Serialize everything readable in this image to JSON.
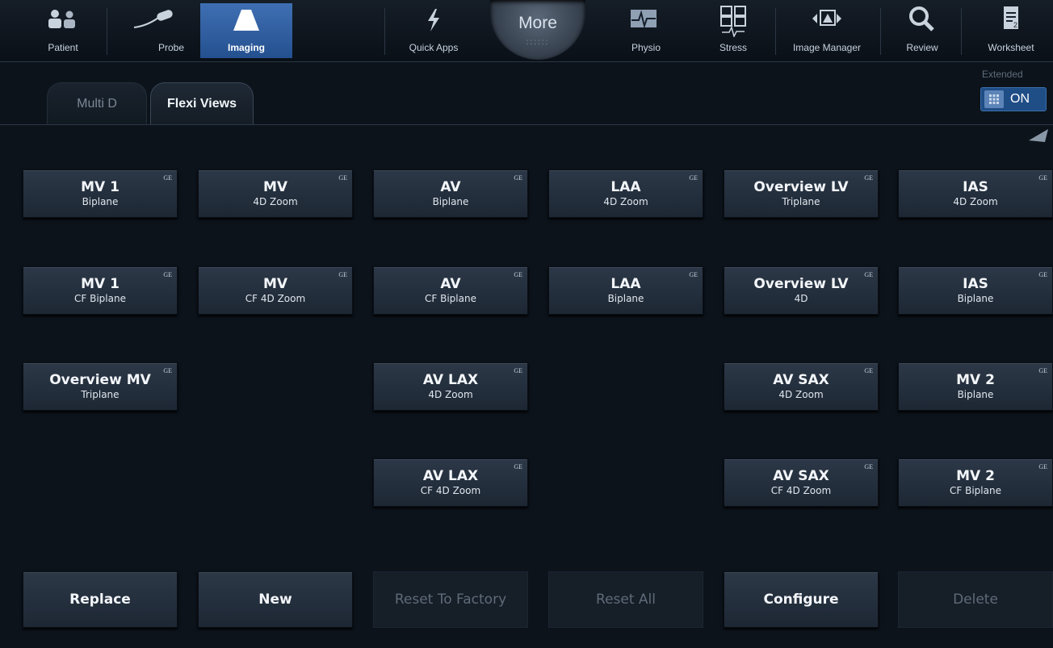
{
  "toolbar": {
    "items": [
      {
        "label": "Patient",
        "icon": "patient-icon"
      },
      {
        "label": "Probe",
        "icon": "probe-icon"
      },
      {
        "label": "Imaging",
        "icon": "imaging-icon",
        "active": true
      },
      {
        "label": "Quick Apps",
        "icon": "lightning-icon"
      },
      {
        "label": "Physio",
        "icon": "ecg-icon"
      },
      {
        "label": "Stress",
        "icon": "stress-icon"
      },
      {
        "label": "Image Manager",
        "icon": "image-manager-icon"
      },
      {
        "label": "Review",
        "icon": "magnifier-icon"
      },
      {
        "label": "Worksheet",
        "icon": "worksheet-icon"
      }
    ],
    "more": {
      "label": "More",
      "dots": "::::::"
    }
  },
  "tabs": [
    {
      "label": "Multi D",
      "active": false
    },
    {
      "label": "Flexi Views",
      "active": true
    }
  ],
  "extended": {
    "label": "Extended",
    "state": "ON"
  },
  "presets": {
    "badge": "GE",
    "items": [
      {
        "title": "MV 1",
        "sub": "Biplane"
      },
      {
        "title": "MV",
        "sub": "4D Zoom"
      },
      {
        "title": "AV",
        "sub": "Biplane"
      },
      {
        "title": "LAA",
        "sub": "4D Zoom"
      },
      {
        "title": "Overview LV",
        "sub": "Triplane"
      },
      {
        "title": "IAS",
        "sub": "4D Zoom"
      },
      {
        "title": "MV 1",
        "sub": "CF Biplane"
      },
      {
        "title": "MV",
        "sub": "CF 4D Zoom"
      },
      {
        "title": "AV",
        "sub": "CF Biplane"
      },
      {
        "title": "LAA",
        "sub": "Biplane"
      },
      {
        "title": "Overview LV",
        "sub": "4D"
      },
      {
        "title": "IAS",
        "sub": "Biplane"
      },
      {
        "title": "Overview MV",
        "sub": "Triplane"
      },
      {
        "title": "AV LAX",
        "sub": "4D Zoom"
      },
      {
        "title": "AV SAX",
        "sub": "4D Zoom"
      },
      {
        "title": "MV 2",
        "sub": "Biplane"
      },
      {
        "title": "AV LAX",
        "sub": "CF 4D Zoom"
      },
      {
        "title": "AV SAX",
        "sub": "CF 4D Zoom"
      },
      {
        "title": "MV 2",
        "sub": "CF Biplane"
      }
    ]
  },
  "actions": [
    {
      "label": "Replace",
      "enabled": true
    },
    {
      "label": "New",
      "enabled": true
    },
    {
      "label": "Reset To Factory",
      "enabled": false
    },
    {
      "label": "Reset All",
      "enabled": false
    },
    {
      "label": "Configure",
      "enabled": true
    },
    {
      "label": "Delete",
      "enabled": false
    }
  ],
  "colors": {
    "accent": "#2f5fa3",
    "background": "#0c131b",
    "button": "#253140"
  }
}
